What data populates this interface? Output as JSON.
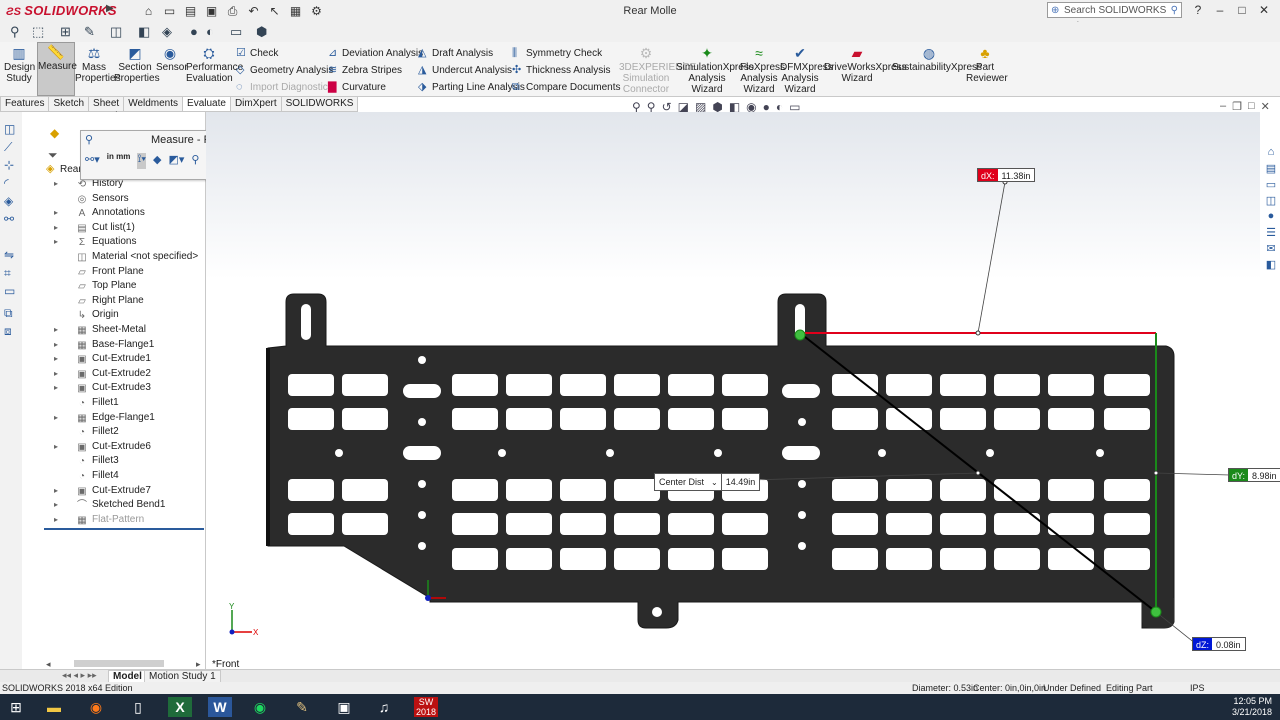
{
  "app": {
    "logo_text": "SOLIDWORKS",
    "window_title": "Rear Molle",
    "search_placeholder": "Search SOLIDWORKS Help"
  },
  "ribbon": {
    "design_study": "Design Study",
    "measure": "Measure",
    "mass_properties": "Mass Properties",
    "section_properties": "Section Properties",
    "sensor": "Sensor",
    "performance_evaluation": "Performance Evaluation",
    "check": "Check",
    "geometry_analysis": "Geometry Analysis",
    "import_diagnostics": "Import Diagnostics",
    "deviation_analysis": "Deviation Analysis",
    "zebra_stripes": "Zebra Stripes",
    "curvature": "Curvature",
    "draft_analysis": "Draft Analysis",
    "undercut_analysis": "Undercut Analysis",
    "parting_line_analysis": "Parting Line Analysis",
    "symmetry_check": "Symmetry Check",
    "thickness_analysis": "Thickness Analysis",
    "compare_documents": "Compare Documents",
    "experience_connector": "3DEXPERIENCE Simulation Connector",
    "simulationxpress": "SimulationXpress Analysis Wizard",
    "floxpress": "FloXpress Analysis Wizard",
    "dfmxpress": "DFMXpress Analysis Wizard",
    "driveworksxpress": "DriveWorksXpress Wizard",
    "sustainabilityxpress": "SustainabilityXpress",
    "part_reviewer": "Part Reviewer"
  },
  "tabs": [
    "Features",
    "Sketch",
    "Sheet Metal",
    "Weldments",
    "Evaluate",
    "DimXpert",
    "SOLIDWORKS CAM"
  ],
  "active_tab": "Evaluate",
  "measure_dialog": {
    "title": "Measure - Rear Molle",
    "help": "?",
    "close": "×",
    "units_label": "in mm"
  },
  "tree": {
    "root": "Rear",
    "items": [
      {
        "label": "History",
        "expand": true
      },
      {
        "label": "Sensors",
        "expand": false
      },
      {
        "label": "Annotations",
        "expand": true
      },
      {
        "label": "Cut list(1)",
        "expand": true
      },
      {
        "label": "Equations",
        "expand": true
      },
      {
        "label": "Material <not specified>",
        "expand": false
      },
      {
        "label": "Front Plane",
        "expand": false
      },
      {
        "label": "Top Plane",
        "expand": false
      },
      {
        "label": "Right Plane",
        "expand": false
      },
      {
        "label": "Origin",
        "expand": false
      },
      {
        "label": "Sheet-Metal",
        "expand": true
      },
      {
        "label": "Base-Flange1",
        "expand": true
      },
      {
        "label": "Cut-Extrude1",
        "expand": true
      },
      {
        "label": "Cut-Extrude2",
        "expand": true
      },
      {
        "label": "Cut-Extrude3",
        "expand": true
      },
      {
        "label": "Fillet1",
        "expand": false
      },
      {
        "label": "Edge-Flange1",
        "expand": true
      },
      {
        "label": "Fillet2",
        "expand": false
      },
      {
        "label": "Cut-Extrude6",
        "expand": true
      },
      {
        "label": "Fillet3",
        "expand": false
      },
      {
        "label": "Fillet4",
        "expand": false
      },
      {
        "label": "Cut-Extrude7",
        "expand": true
      },
      {
        "label": "Sketched Bend1",
        "expand": true
      },
      {
        "label": "Flat-Pattern",
        "expand": true
      }
    ]
  },
  "measurements": {
    "dx": {
      "tag": "dX:",
      "value": "11.38in",
      "color": "#e0001b"
    },
    "dy": {
      "tag": "dY:",
      "value": "8.98in",
      "color": "#1a8a1a"
    },
    "dz": {
      "tag": "dZ:",
      "value": "0.08in",
      "color": "#0018d6"
    },
    "center_dist": {
      "label": "Center Dist",
      "value": "14.49in"
    }
  },
  "viewport": {
    "view_label": "*Front"
  },
  "bottom_tabs": [
    "Model",
    "Motion Study 1"
  ],
  "active_bottom_tab": "Model",
  "status": {
    "edition": "SOLIDWORKS 2018 x64 Edition",
    "diameter": "Diameter: 0.53in",
    "center": "Center: 0in,0in,0in",
    "defined": "Under Defined",
    "editing": "Editing Part",
    "units": "IPS"
  },
  "taskbar": {
    "time": "12:05 PM",
    "date": "3/21/2018",
    "sw_label": "2018"
  },
  "colors": {
    "part": "#2b2b2b",
    "accent": "#2a5b9c"
  }
}
